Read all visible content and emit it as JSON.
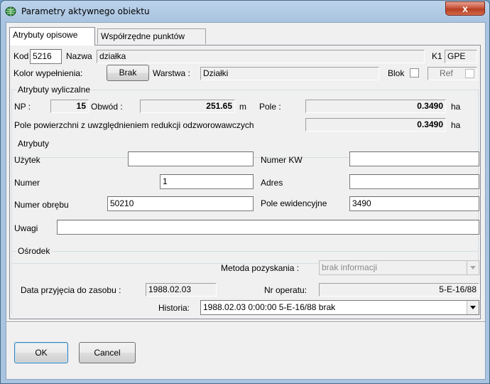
{
  "window": {
    "title": "Parametry aktywnego obiektu",
    "close_label": "x"
  },
  "tabs": [
    {
      "label": "Atrybuty opisowe"
    },
    {
      "label": "Współrzędne punktów"
    }
  ],
  "header": {
    "kod_label": "Kod",
    "kod_value": "5216",
    "nazwa_label": "Nazwa",
    "nazwa_value": "działka",
    "k1_label": "K1",
    "k1_value": "GPE",
    "kolor_label": "Kolor wypełnienia:",
    "kolor_button": "Brak",
    "warstwa_label": "Warstwa :",
    "warstwa_value": "Działki",
    "blok_label": "Blok",
    "ref_label": "Ref"
  },
  "computed": {
    "title": "Atrybuty wyliczalne",
    "np_label": "NP :",
    "np_value": "15",
    "obwod_label": "Obwód :",
    "obwod_value": "251.65",
    "obwod_unit": "m",
    "pole_label": "Pole :",
    "pole_value": "0.3490",
    "pole_unit": "ha",
    "reduced_label": "Pole powierzchni z uwzględnieniem redukcji odzworowawczych",
    "reduced_value": "0.3490",
    "reduced_unit": "ha"
  },
  "attributes": {
    "title": "Atrybuty",
    "uzytek_label": "Użytek",
    "uzytek_value": "",
    "numer_kw_label": "Numer KW",
    "numer_kw_value": "",
    "numer_label": "Numer",
    "numer_value": "1",
    "adres_label": "Adres",
    "adres_value": "",
    "obreb_label": "Numer obrębu",
    "obreb_value": "50210",
    "pole_ew_label": "Pole ewidencyjne",
    "pole_ew_value": "3490",
    "uwagi_label": "Uwagi",
    "uwagi_value": ""
  },
  "osrodek": {
    "title": "Ośrodek",
    "metoda_label": "Metoda pozyskania :",
    "metoda_value": "brak informacji",
    "data_label": "Data przyjęcia do zasobu :",
    "data_value": "1988.02.03",
    "operat_label": "Nr operatu:",
    "operat_value": "5-E-16/88",
    "historia_label": "Historia:",
    "historia_value": "1988.02.03  0:00:00 5-E-16/88 brak"
  },
  "buttons": {
    "ok": "OK",
    "cancel": "Cancel"
  },
  "colors": {
    "title_bar": "#a9c4e0",
    "close_button": "#c8553c",
    "dialog_bg": "#f0f0f0"
  }
}
